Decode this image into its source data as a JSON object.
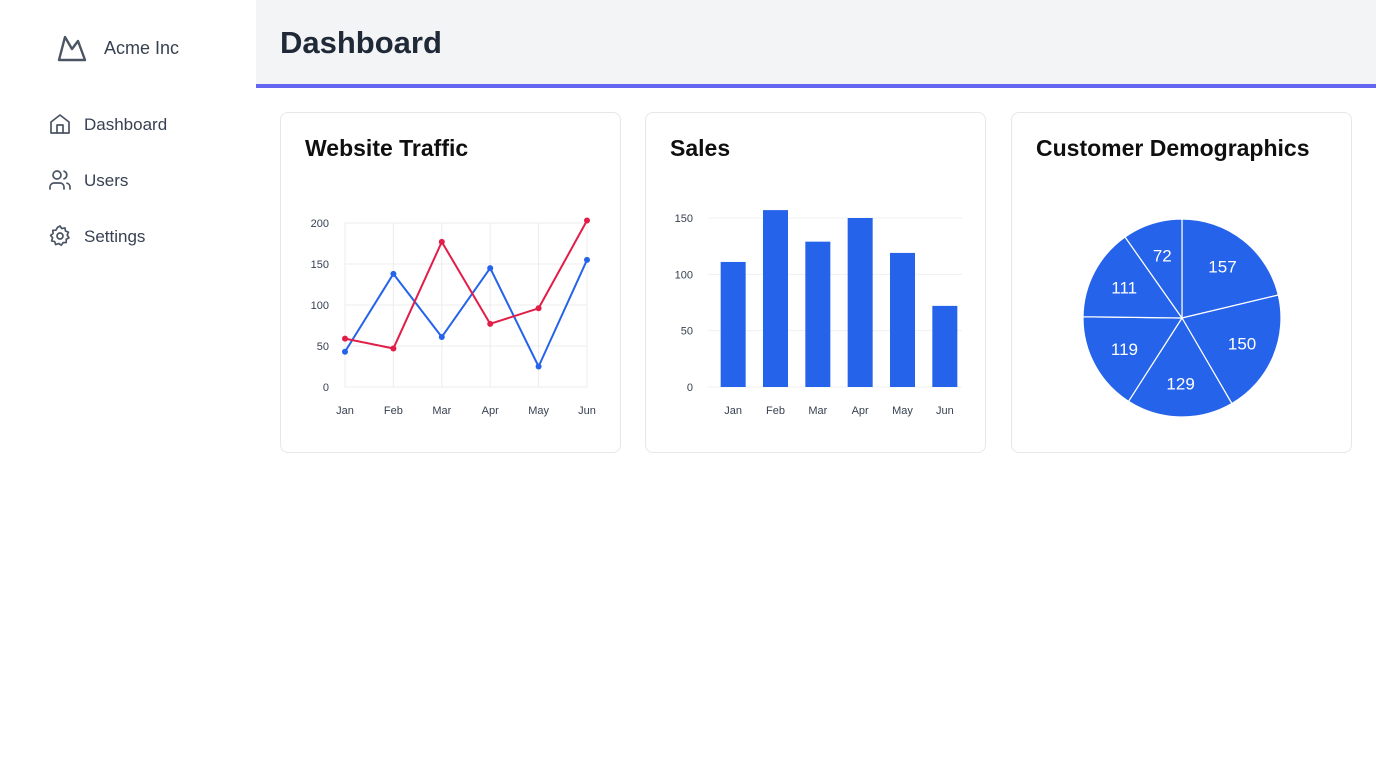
{
  "brand": {
    "name": "Acme Inc",
    "logo_icon": "mountain-icon"
  },
  "sidebar": {
    "items": [
      {
        "label": "Dashboard",
        "icon": "home-icon"
      },
      {
        "label": "Users",
        "icon": "users-icon"
      },
      {
        "label": "Settings",
        "icon": "gear-icon"
      }
    ]
  },
  "header": {
    "title": "Dashboard"
  },
  "colors": {
    "accent": "#6366f1",
    "blue": "#2563eb",
    "red": "#e11d48",
    "header_bg": "#f3f4f6"
  },
  "cards": [
    {
      "title": "Website Traffic"
    },
    {
      "title": "Sales"
    },
    {
      "title": "Customer Demographics"
    }
  ],
  "chart_data": [
    {
      "type": "line",
      "title": "Website Traffic",
      "categories": [
        "Jan",
        "Feb",
        "Mar",
        "Apr",
        "May",
        "Jun"
      ],
      "series": [
        {
          "color": "#2563eb",
          "values": [
            43,
            138,
            61,
            145,
            25,
            155
          ]
        },
        {
          "color": "#e11d48",
          "values": [
            59,
            47,
            177,
            77,
            96,
            203
          ]
        }
      ],
      "yticks": [
        0,
        50,
        100,
        150,
        200
      ],
      "ylim": [
        0,
        200
      ],
      "grid": true
    },
    {
      "type": "bar",
      "title": "Sales",
      "categories": [
        "Jan",
        "Feb",
        "Mar",
        "Apr",
        "May",
        "Jun"
      ],
      "values": [
        111,
        157,
        129,
        150,
        119,
        72
      ],
      "yticks": [
        0,
        50,
        100,
        150
      ],
      "ylim": [
        0,
        150
      ],
      "grid": true,
      "color": "#2563eb"
    },
    {
      "type": "pie",
      "title": "Customer Demographics",
      "values": [
        157,
        150,
        129,
        119,
        111,
        72
      ],
      "color": "#2563eb"
    }
  ]
}
